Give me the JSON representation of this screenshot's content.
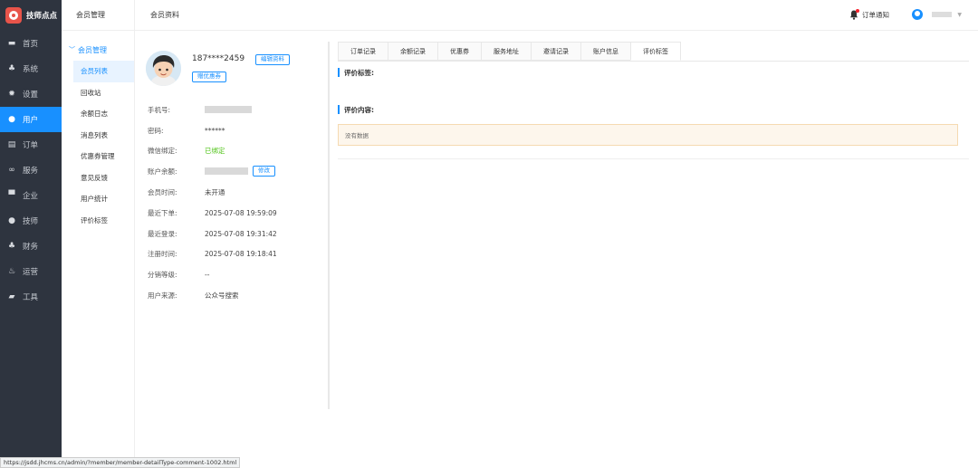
{
  "app": {
    "name": "技师点点"
  },
  "sidebar": {
    "items": [
      {
        "label": "首页",
        "icon": "monitor-icon"
      },
      {
        "label": "系统",
        "icon": "sitemap-icon"
      },
      {
        "label": "设置",
        "icon": "gear-icon"
      },
      {
        "label": "用户",
        "icon": "user-icon"
      },
      {
        "label": "订单",
        "icon": "clipboard-icon"
      },
      {
        "label": "服务",
        "icon": "link-icon"
      },
      {
        "label": "企业",
        "icon": "building-icon"
      },
      {
        "label": "技师",
        "icon": "user-icon"
      },
      {
        "label": "财务",
        "icon": "sitemap-icon"
      },
      {
        "label": "运营",
        "icon": "fire-icon"
      },
      {
        "label": "工具",
        "icon": "toolbox-icon"
      }
    ],
    "active_index": 3
  },
  "subnav": {
    "header": "会员管理",
    "group": "会员管理",
    "items": [
      "会员列表",
      "回收站",
      "余额日志",
      "消息列表",
      "优惠券管理",
      "意见反馈",
      "用户统计",
      "评价标签"
    ],
    "active_index": 0
  },
  "topbar": {
    "title": "会员资料",
    "notification": "订单通知"
  },
  "profile": {
    "phone": "187****2459",
    "edit_button": "编辑资料",
    "coupon_button": "赠优惠券",
    "fix_button": "修改",
    "rows": [
      {
        "label": "手机号:",
        "value": ""
      },
      {
        "label": "密码:",
        "value": "******"
      },
      {
        "label": "微信绑定:",
        "value": "已绑定"
      },
      {
        "label": "账户余额:",
        "value": ""
      },
      {
        "label": "会员时间:",
        "value": "未开通"
      },
      {
        "label": "最近下单:",
        "value": "2025-07-08 19:59:09"
      },
      {
        "label": "最近登录:",
        "value": "2025-07-08 19:31:42"
      },
      {
        "label": "注册时间:",
        "value": "2025-07-08 19:18:41"
      },
      {
        "label": "分销等级:",
        "value": "--"
      },
      {
        "label": "用户来源:",
        "value": "公众号搜索"
      }
    ]
  },
  "tabs": {
    "items": [
      "订单记录",
      "余额记录",
      "优惠券",
      "服务地址",
      "邀请记录",
      "账户信息",
      "评价标签"
    ],
    "active_index": 6
  },
  "content": {
    "section1_title": "评价标签:",
    "section2_title": "评价内容:",
    "empty_text": "没有数据"
  },
  "statusbar": {
    "url": "https://jsdd.jhcms.cn/admin/?member/member-detailType-comment-1002.html"
  },
  "colors": {
    "accent": "#1890ff",
    "sidebar_bg": "#2e343f",
    "success": "#52c41a"
  }
}
